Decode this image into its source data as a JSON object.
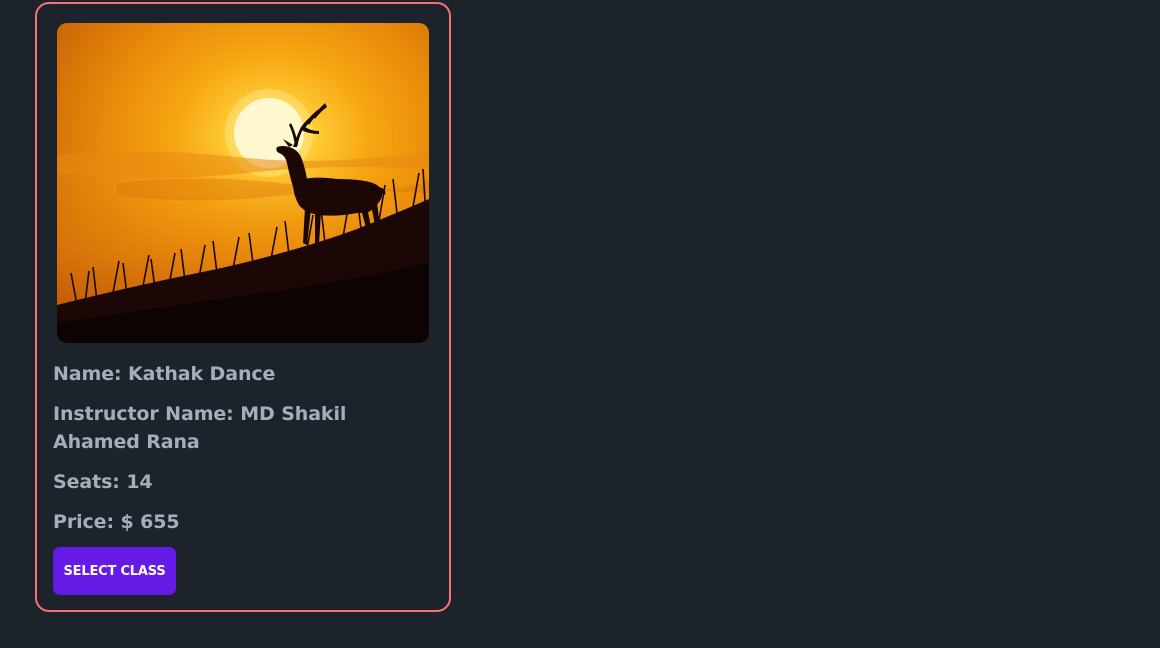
{
  "card": {
    "image": {
      "description_icon": "deer-sunset-image"
    },
    "name_label": "Name:",
    "name_value": "Kathak Dance",
    "instructor_label": "Instructor Name:",
    "instructor_value": "MD Shakil Ahamed Rana",
    "seats_label": "Seats:",
    "seats_value": "14",
    "price_label": "Price:",
    "price_value": "$ 655",
    "button_label": "SELECT CLASS"
  },
  "colors": {
    "background": "#1d232a",
    "card_border": "#f87272",
    "text": "#a6adbb",
    "button": "#661ae6",
    "button_text": "#ffffff"
  }
}
